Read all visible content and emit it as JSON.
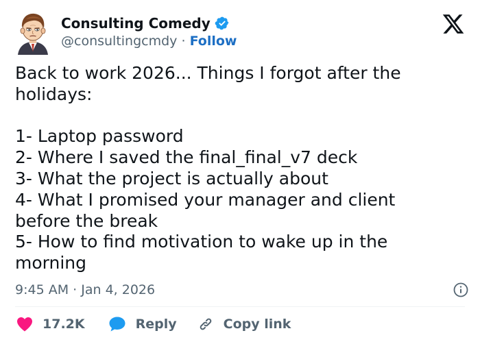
{
  "author": {
    "display_name": "Consulting Comedy",
    "handle": "@consultingcmdy",
    "separator": " · ",
    "follow_label": "Follow",
    "verified": true
  },
  "tweet": {
    "lines": [
      "Back to work 2026... Things I forgot after the",
      "holidays:",
      "",
      "1- Laptop password",
      "2- Where I saved the final_final_v7 deck",
      "3- What the project is actually about",
      "4- What I promised your manager and client",
      "before the break",
      "5- How to find motivation to wake up in the",
      "morning"
    ]
  },
  "meta": {
    "time": "9:45 AM",
    "separator": " · ",
    "date": "Jan 4, 2026"
  },
  "actions": {
    "like_count": "17.2K",
    "reply_label": "Reply",
    "copy_link_label": "Copy link"
  },
  "colors": {
    "like_red": "#f91880",
    "reply_blue": "#1d9bf0",
    "verified_blue": "#1d9bf0",
    "follow_blue": "#1d6fc4",
    "muted_gray": "#536471",
    "text_dark": "#0f1419"
  },
  "icons": {
    "avatar": "cartoon-consultant-avatar",
    "verified": "verified-badge-icon",
    "x_logo": "x-logo-icon",
    "info": "info-icon",
    "like": "heart-icon",
    "reply": "speech-bubble-icon",
    "copy_link": "link-icon"
  }
}
